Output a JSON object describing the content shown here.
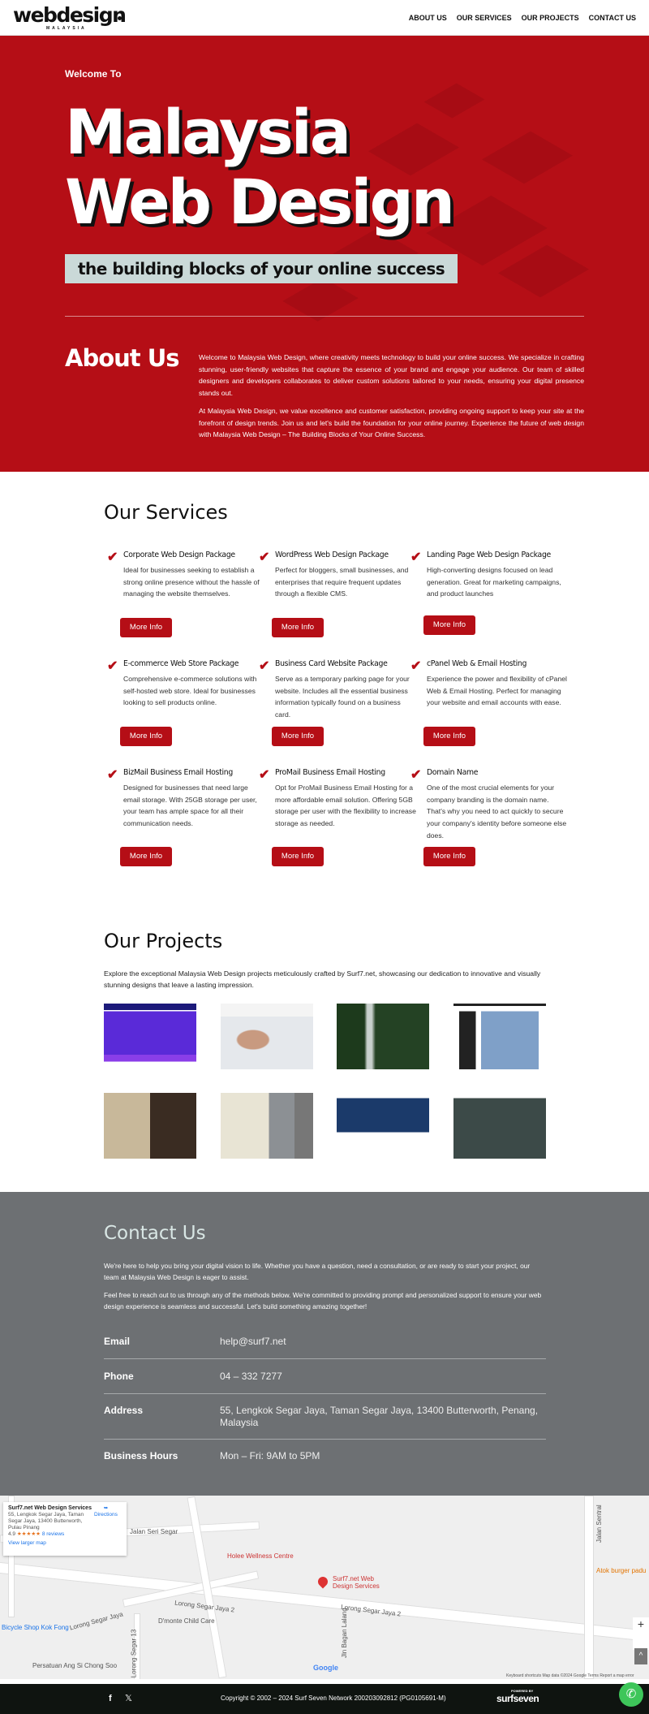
{
  "header": {
    "logo": "webdesign",
    "logo_sub": "MALAYSIA",
    "nav": [
      "ABOUT US",
      "OUR SERVICES",
      "OUR PROJECTS",
      "CONTACT US"
    ]
  },
  "hero": {
    "welcome": "Welcome To",
    "title_line1": "Malaysia",
    "title_line2": "Web Design",
    "tagline": "the building blocks of your online success"
  },
  "about": {
    "heading": "About Us",
    "paragraphs": [
      "Welcome to Malaysia Web Design, where creativity meets technology to build your online success. We specialize in crafting stunning, user-friendly websites that capture the essence of your brand and engage your audience. Our team of skilled designers and developers collaborates to deliver custom solutions tailored to your needs, ensuring your digital presence stands out.",
      "At Malaysia Web Design, we value excellence and customer satisfaction, providing ongoing support to keep your site at the forefront of design trends. Join us and let's build the foundation for your online journey. Experience the future of web design with Malaysia Web Design – The Building Blocks of Your Online Success."
    ]
  },
  "services": {
    "heading": "Our Services",
    "button_label": "More Info",
    "items": [
      {
        "title": "Corporate Web Design Package",
        "desc": "Ideal for businesses seeking to establish a strong online presence without the hassle of managing the website themselves."
      },
      {
        "title": "WordPress Web Design Package",
        "desc": "Perfect for bloggers, small businesses, and enterprises that require frequent updates through a flexible CMS."
      },
      {
        "title": "Landing Page Web Design Package",
        "desc": "High-converting designs focused on lead generation. Great for marketing campaigns, and product launches"
      },
      {
        "title": "E-commerce Web Store Package",
        "desc": "Comprehensive e-commerce solutions with self-hosted web store. Ideal for businesses looking to sell products online."
      },
      {
        "title": "Business Card Website Package",
        "desc": "Serve as a temporary parking page for your website. Includes all the essential business information typically found on a business card."
      },
      {
        "title": "cPanel Web & Email Hosting",
        "desc": "Experience the power and flexibility of cPanel Web & Email Hosting. Perfect for managing your website and email accounts with ease."
      },
      {
        "title": "BizMail Business Email Hosting",
        "desc": "Designed for businesses that need large email storage. With 25GB storage per user, your team has ample space for all their communication needs."
      },
      {
        "title": "ProMail Business Email Hosting",
        "desc": "Opt for ProMail Business Email Hosting for a more affordable email solution. Offering 5GB storage per user with the flexibility to increase storage as needed."
      },
      {
        "title": "Domain Name",
        "desc": "One of the most crucial elements for your company branding is the domain name. That's why you need to act quickly to secure your company's identity before someone else does."
      }
    ]
  },
  "projects": {
    "heading": "Our Projects",
    "intro": "Explore the exceptional Malaysia Web Design projects meticulously crafted by Surf7.net, showcasing our dedication to innovative and visually stunning designs that leave a lasting impression."
  },
  "contact": {
    "heading": "Contact Us",
    "paragraphs": [
      "We're here to help you bring your digital vision to life. Whether you have a question, need a consultation, or are ready to start your project, our team at Malaysia Web Design is eager to assist.",
      "Feel free to reach out to us through any of the methods below. We're committed to providing prompt and personalized support to ensure your web design experience is seamless and successful. Let's build something amazing together!"
    ],
    "rows": [
      {
        "label": "Email",
        "value": "help@surf7.net"
      },
      {
        "label": "Phone",
        "value": "04 – 332 7277"
      },
      {
        "label": "Address",
        "value": "55, Lengkok Segar Jaya, Taman Segar Jaya, 13400 Butterworth, Penang, Malaysia"
      },
      {
        "label": "Business Hours",
        "value": "Mon – Fri: 9AM to 5PM"
      }
    ]
  },
  "map": {
    "place_name": "Surf7.net Web Design Services",
    "place_address": "55, Lengkok Segar Jaya, Taman Segar Jaya, 13400 Butterworth, Pulau Pinang",
    "rating": "4.9",
    "stars": "★★★★★",
    "reviews": "8 reviews",
    "directions": "Directions",
    "larger_map": "View larger map",
    "pin_label": "Surf7.net Web Design Services",
    "labels": [
      "Jalan Seri Segar",
      "Lorong Segar Jaya 2",
      "Lorong Segar Jaya",
      "Lorong Segar 13",
      "Holee Wellness Centre",
      "D'monte Child Care",
      "Bicycle Shop Kok Fong",
      "Atok burger padu",
      "Jln Bagan Lalang",
      "Jalan Sentral",
      "Persatuan Ang Si Chong Soo"
    ],
    "google": "Google",
    "attribution": "Keyboard shortcuts   Map data ©2024 Google   Terms   Report a map error"
  },
  "footer": {
    "copyright": "Copyright © 2002 – 2024 Surf Seven Network 200203092812 (PG0105691-M)",
    "powered_by": "POWERED BY",
    "brand": "surfseven"
  },
  "colors": {
    "brand_red": "#b50e16",
    "contact_bg": "#6d7073",
    "footer_bg": "#0f1410",
    "whatsapp": "#3ec65a"
  }
}
